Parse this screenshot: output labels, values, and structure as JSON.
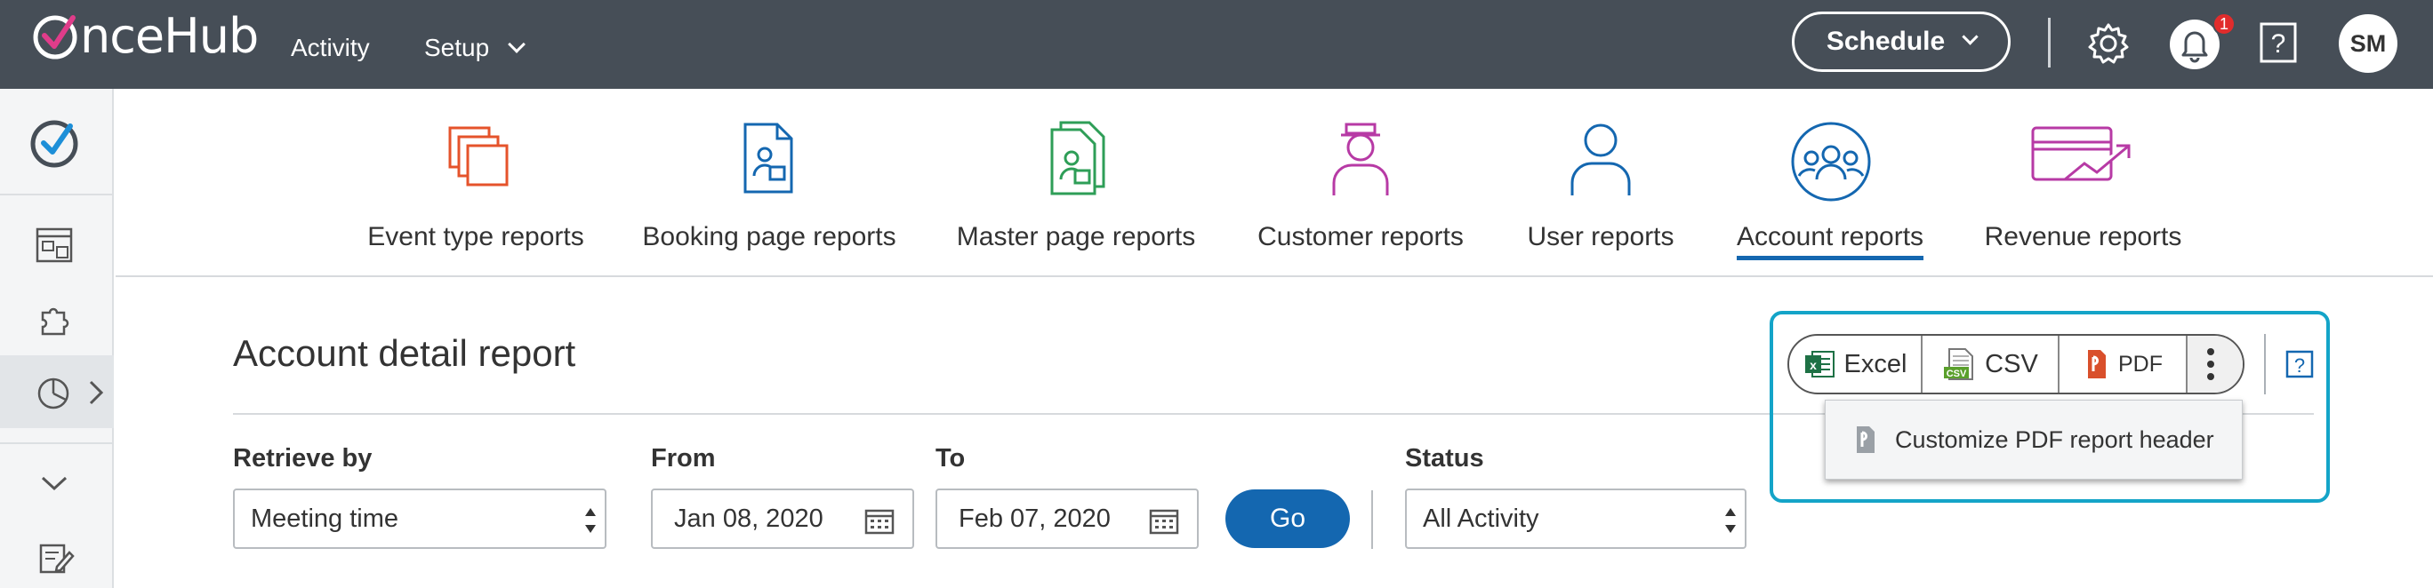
{
  "header": {
    "logo_text": "nceHub",
    "nav": [
      {
        "label": "Activity"
      },
      {
        "label": "Setup"
      }
    ],
    "schedule_label": "Schedule",
    "notification_count": "1",
    "user_initials": "SM"
  },
  "sidebar": {
    "items": [
      {
        "icon": "checkmark-circle-icon"
      },
      {
        "icon": "booking-page-icon"
      },
      {
        "icon": "puzzle-icon"
      },
      {
        "icon": "pie-chart-icon",
        "active": true
      },
      {
        "icon": "chevron-down-icon"
      },
      {
        "icon": "edit-notes-icon"
      }
    ]
  },
  "report_tabs": [
    {
      "label": "Event type reports",
      "icon": "event-type-icon",
      "color": "#e5532b"
    },
    {
      "label": "Booking page reports",
      "icon": "booking-page-icon",
      "color": "#1467b0"
    },
    {
      "label": "Master page reports",
      "icon": "master-page-icon",
      "color": "#2e9e57"
    },
    {
      "label": "Customer reports",
      "icon": "customer-icon",
      "color": "#b73aa5"
    },
    {
      "label": "User reports",
      "icon": "user-icon",
      "color": "#1467b0"
    },
    {
      "label": "Account reports",
      "icon": "account-icon",
      "color": "#1467b0",
      "active": true
    },
    {
      "label": "Revenue reports",
      "icon": "revenue-icon",
      "color": "#b73aa5"
    }
  ],
  "page": {
    "title": "Account detail report"
  },
  "filters": {
    "retrieve_by": {
      "label": "Retrieve by",
      "value": "Meeting time"
    },
    "from": {
      "label": "From",
      "value": "Jan 08, 2020"
    },
    "to": {
      "label": "To",
      "value": "Feb 07, 2020"
    },
    "go_label": "Go",
    "status": {
      "label": "Status",
      "value": "All Activity"
    }
  },
  "export": {
    "excel_label": "Excel",
    "csv_label": "CSV",
    "pdf_label": "PDF",
    "menu_item": "Customize PDF report header"
  },
  "colors": {
    "topbar": "#464e57",
    "accent": "#1467b0",
    "highlight": "#14a4c8"
  }
}
